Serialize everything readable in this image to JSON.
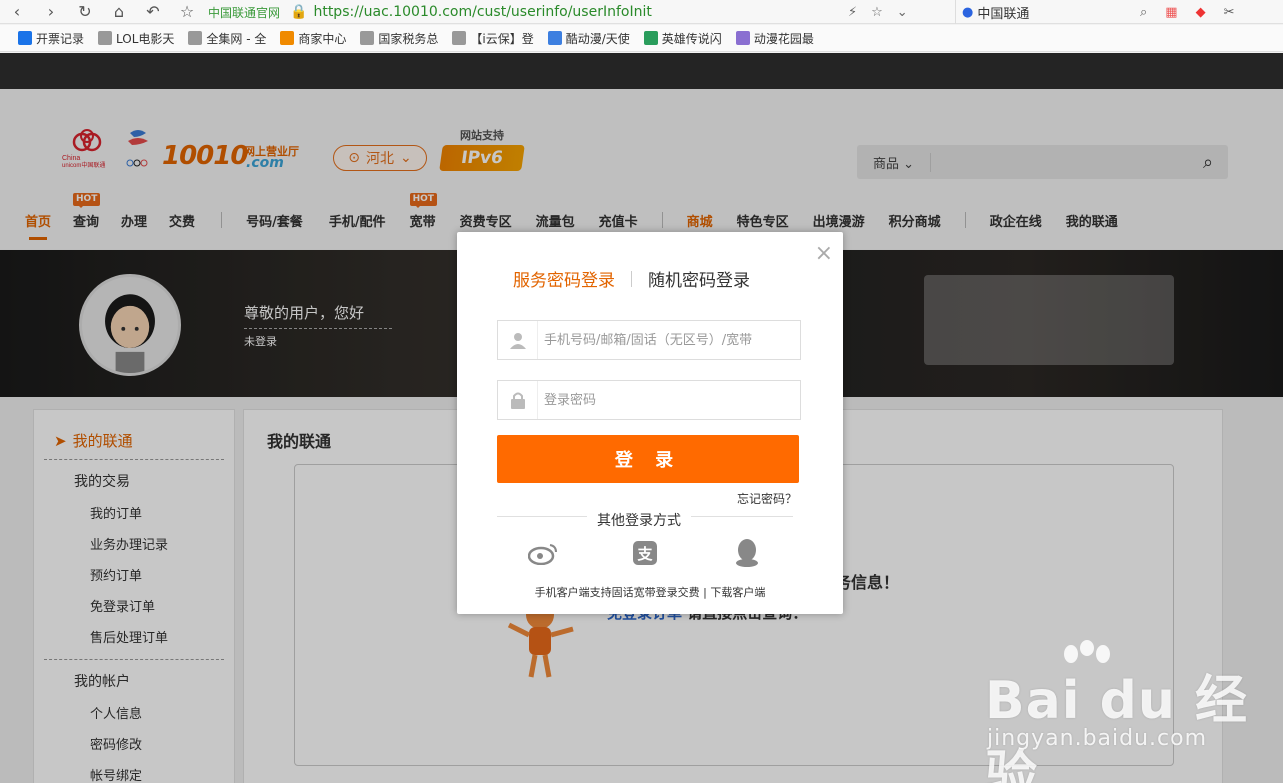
{
  "browser": {
    "site_badge": "中国联通官网",
    "url": "https://uac.10010.com/cust/userinfo/userInfoInit",
    "search_engine_text": "中国联通"
  },
  "bookmarks": [
    {
      "label": "开票记录",
      "color": "#1a73e8"
    },
    {
      "label": "LOL电影天",
      "color": "#999999"
    },
    {
      "label": "全集网 - 全",
      "color": "#999999"
    },
    {
      "label": "商家中心",
      "color": "#f08a00"
    },
    {
      "label": "国家税务总",
      "color": "#999999"
    },
    {
      "label": "【i云保】登",
      "color": "#999999"
    },
    {
      "label": "酷动漫/天使",
      "color": "#3d7fe0"
    },
    {
      "label": "英雄传说闪",
      "color": "#2a9d5c"
    },
    {
      "label": "动漫花园最",
      "color": "#8a6fd1"
    }
  ],
  "header": {
    "logo_main": "10010",
    "logo_sub": "网上营业厅",
    "logo_com": ".com",
    "region": "河北",
    "ipv6_caption": "网站支持",
    "ipv6_badge": "IPv6",
    "search_category": "商品"
  },
  "nav": {
    "hot_label": "HOT",
    "items": [
      "首页",
      "查询",
      "办理",
      "交费",
      "号码/套餐",
      "手机/配件",
      "宽带",
      "资费专区",
      "流量包",
      "充值卡",
      "商城",
      "特色专区",
      "出境漫游",
      "积分商城",
      "政企在线",
      "我的联通"
    ]
  },
  "hero": {
    "greeting": "尊敬的用户，您好",
    "login_state": "未登录"
  },
  "sidebar": {
    "title": "我的联通",
    "group1": "我的交易",
    "group1_items": [
      "我的订单",
      "业务办理记录",
      "预约订单",
      "免登录订单",
      "售后处理订单"
    ],
    "group2": "我的帐户",
    "group2_items": [
      "个人信息",
      "密码修改",
      "帐号绑定"
    ]
  },
  "main": {
    "title": "我的联通",
    "notice1": "务信息！",
    "notice2_link": "免登录订单",
    "notice2_rest": "请直接点击查询："
  },
  "modal": {
    "tab_active": "服务密码登录",
    "tab_other": "随机密码登录",
    "username_placeholder": "手机号码/邮箱/固话（无区号）/宽带",
    "password_placeholder": "登录密码",
    "login_button": "登 录",
    "forgot": "忘记密码？",
    "other_methods": "其他登录方式",
    "footer_text": "手机客户端支持固话宽带登录交费",
    "footer_sep": " | ",
    "footer_link": "下载客户端"
  },
  "watermark": {
    "brand": "Bai du 经验",
    "domain": "jingyan.baidu.com"
  }
}
